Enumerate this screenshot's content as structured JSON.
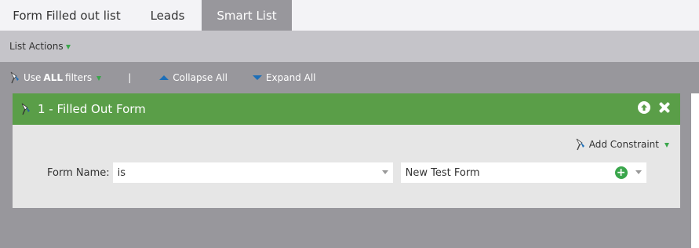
{
  "tabs": [
    {
      "label": "Form Filled out list",
      "active": false
    },
    {
      "label": "Leads",
      "active": false
    },
    {
      "label": "Smart List",
      "active": true
    }
  ],
  "actions_bar": {
    "list_actions": "List Actions"
  },
  "toolbar": {
    "use_prefix": "Use",
    "use_emphasis": "ALL",
    "use_suffix": "filters",
    "separator": "|",
    "collapse_all": "Collapse All",
    "expand_all": "Expand All"
  },
  "filter": {
    "title": "1 - Filled Out Form",
    "add_constraint": "Add Constraint",
    "field_label": "Form Name:",
    "operator": "is",
    "value": "New Test Form"
  },
  "colors": {
    "header_green": "#5a9e48",
    "accent_green": "#3aa64b",
    "arrow_blue": "#1d6fb8",
    "background_gray": "#98979c"
  },
  "icons": [
    "funnel-icon",
    "chevron-down-icon",
    "arrow-up-icon",
    "arrow-down-icon",
    "circle-up-icon",
    "close-icon",
    "plus-icon"
  ]
}
